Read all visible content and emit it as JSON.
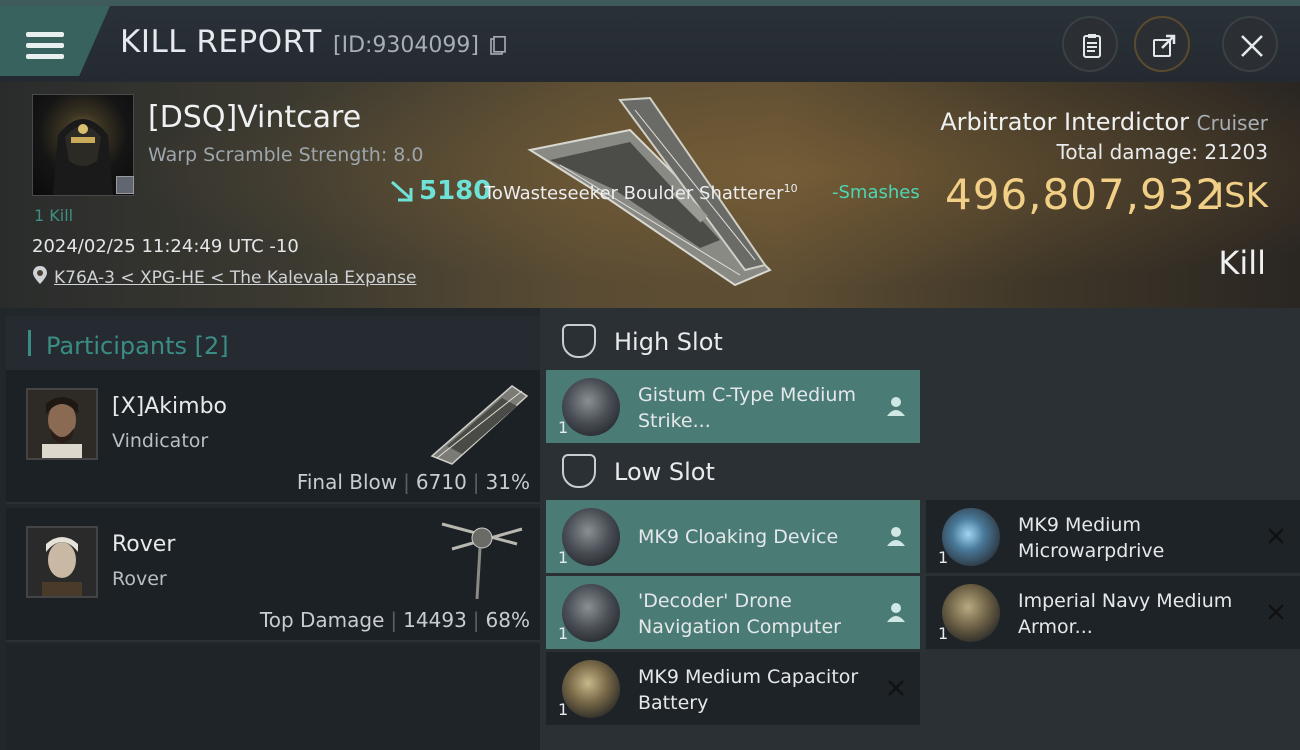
{
  "header": {
    "title": "KILL REPORT",
    "report_id": "[ID:9304099]"
  },
  "victim": {
    "name": "[DSQ]Vintcare",
    "warp_scramble": "Warp Scramble Strength: 8.0",
    "kill_count": "1 Kill",
    "datetime": "2024/02/25 11:24:49 UTC -10",
    "location": "K76A-3 < XPG-HE < The Kalevala Expanse",
    "ship_name": "Arbitrator Interdictor",
    "ship_class": "Cruiser",
    "total_damage_label": "Total damage:",
    "total_damage": "21203",
    "isk_value": "496,807,932",
    "isk_label": "ISK",
    "result": "Kill"
  },
  "damage_event": {
    "amount": "5180",
    "target_prefix": "ToWasteseeker Boulder Shatterer",
    "target_level": "10",
    "verb": "-Smashes"
  },
  "participants": {
    "title": "Participants",
    "count": "[2]",
    "rows": [
      {
        "name": "[X]Akimbo",
        "ship": "Vindicator",
        "role": "Final Blow",
        "damage": "6710",
        "percent": "31%"
      },
      {
        "name": "Rover",
        "ship": "Rover",
        "role": "Top Damage",
        "damage": "14493",
        "percent": "68%"
      }
    ]
  },
  "fitting": {
    "high_slot": {
      "title": "High Slot",
      "items": [
        {
          "name": "Gistum C-Type Medium Strike...",
          "qty": "1",
          "status": "pilot-icon"
        }
      ]
    },
    "low_slot": {
      "title": "Low Slot",
      "items": [
        {
          "name": "MK9 Cloaking Device",
          "qty": "1",
          "status": "pilot-icon"
        },
        {
          "name": "MK9 Medium Microwarpdrive",
          "qty": "1",
          "status": "close-icon"
        },
        {
          "name": "'Decoder' Drone Navigation Computer",
          "qty": "1",
          "status": "pilot-icon"
        },
        {
          "name": "Imperial Navy Medium Armor...",
          "qty": "1",
          "status": "close-icon"
        },
        {
          "name": "MK9 Medium Capacitor Battery",
          "qty": "1",
          "status": "close-icon"
        }
      ]
    }
  },
  "colors": {
    "accent_teal": "#3a8d84",
    "isk_gold": "#f1cf86",
    "highlight_row": "#4b7b75"
  }
}
